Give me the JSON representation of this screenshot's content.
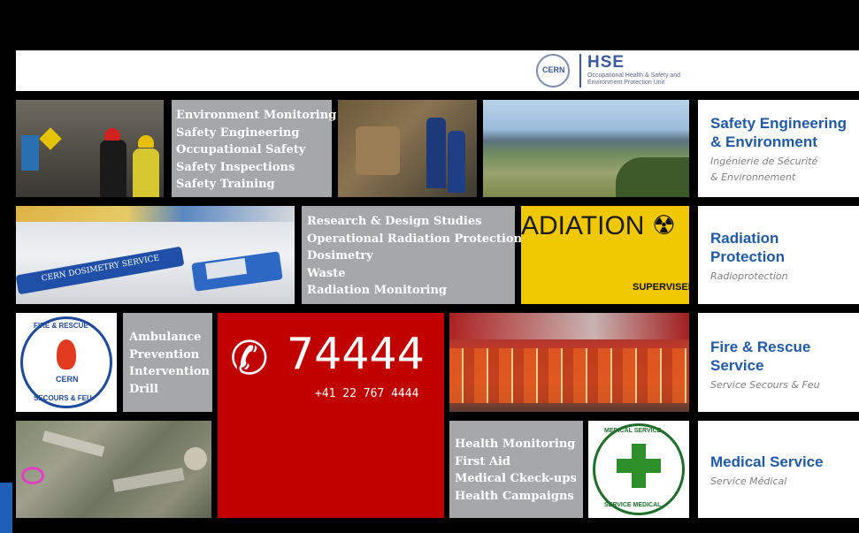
{
  "header": {
    "logo_text": "CERN",
    "title": "HSE",
    "subtitle": "Occupational Health & Safety and Environment Protection Unit"
  },
  "tiles": {
    "environment_list": [
      "Environment Monitoring",
      "Safety Engineering",
      "Occupational Safety",
      "Safety Inspections",
      "Safety Training"
    ],
    "radiation_list": [
      "Research & Design Studies",
      "Operational Radiation Protection",
      "Dosimetry",
      "Waste",
      "Radiation Monitoring"
    ],
    "fire_list": [
      "Ambulance",
      "Prevention",
      "Intervention",
      "Drill"
    ],
    "health_list": [
      "Health Monitoring",
      "First Aid",
      "Medical Ckeck-ups",
      "Health Campaigns"
    ],
    "emergency": {
      "number": "74444",
      "full_number": "+41 22 767 4444"
    },
    "dosimeter_strap_text": "CERN DOSIMETRY SERVICE",
    "radiation_sign_text": "ADIATION",
    "radiation_sign_sub": "SUPERVISED",
    "fire_logo": {
      "top": "FIRE & RESCUE",
      "center": "CERN",
      "bottom": "SECOURS & FEU"
    },
    "medical_logo": {
      "top": "MEDICAL SERVICE",
      "bottom": "SERVICE MEDICAL"
    }
  },
  "sections": [
    {
      "title_line1": "Safety Engineering",
      "title_line2": "& Environment",
      "sub_line1": "Ingénierie de Sécurité",
      "sub_line2": "& Environnement"
    },
    {
      "title_line1": "Radiation",
      "title_line2": "Protection",
      "sub_line1": "Radioprotection",
      "sub_line2": ""
    },
    {
      "title_line1": "Fire & Rescue",
      "title_line2": "Service",
      "sub_line1": "Service Secours & Feu",
      "sub_line2": ""
    },
    {
      "title_line1": "Medical Service",
      "title_line2": "",
      "sub_line1": "Service Médical",
      "sub_line2": ""
    }
  ],
  "colors": {
    "brand_blue": "#1f5aa8",
    "emergency_red": "#c10000",
    "tile_grey": "#a6a7a8"
  }
}
